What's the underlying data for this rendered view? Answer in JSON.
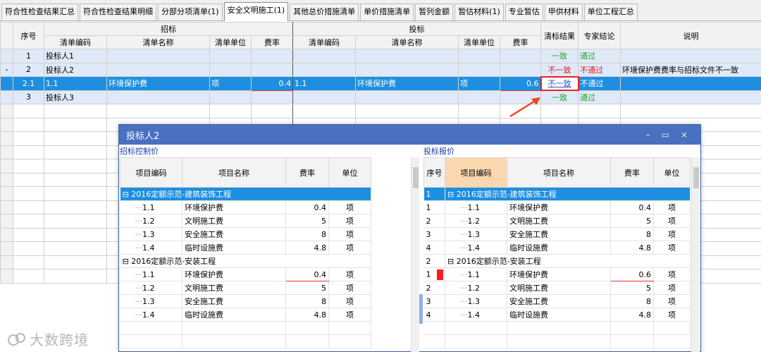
{
  "tabs": [
    {
      "label": "符合性检查结果汇总",
      "active": false
    },
    {
      "label": "符合性检查结果明细",
      "active": false
    },
    {
      "label": "分部分项清单(1)",
      "active": false
    },
    {
      "label": "安全文明施工(1)",
      "active": true
    },
    {
      "label": "其他总价措施清单",
      "active": false
    },
    {
      "label": "单价措施清单",
      "active": false
    },
    {
      "label": "暂列金额",
      "active": false
    },
    {
      "label": "暂估材料(1)",
      "active": false
    },
    {
      "label": "专业暂估",
      "active": false
    },
    {
      "label": "甲供材料",
      "active": false
    },
    {
      "label": "单位工程汇总",
      "active": false
    }
  ],
  "grid": {
    "headers": {
      "seq": "序号",
      "tender_group": "招标",
      "bid_group": "投标",
      "result": "清标结果",
      "expert": "专家结论",
      "note": "说明",
      "code": "清单编码",
      "name": "清单名称",
      "unit": "清单单位",
      "rate": "费率"
    },
    "rows": [
      {
        "mark": "",
        "seq": "1",
        "t_code": "投标人1",
        "t_name": "",
        "t_unit": "",
        "t_rate": "",
        "b_code": "",
        "b_name": "",
        "b_unit": "",
        "b_rate": "",
        "result": "一致",
        "expert": "通过",
        "note": ""
      },
      {
        "mark": "-",
        "seq": "2",
        "t_code": "投标人2",
        "t_name": "",
        "t_unit": "",
        "t_rate": "",
        "b_code": "",
        "b_name": "",
        "b_unit": "",
        "b_rate": "",
        "result": "不一致",
        "expert": "不通过",
        "note": "环境保护费费率与招标文件不一致"
      },
      {
        "mark": "",
        "seq": "2.1",
        "t_code": "1.1",
        "t_name": "环境保护费",
        "t_unit": "项",
        "t_rate": "0.4",
        "b_code": "1.1",
        "b_name": "环境保护费",
        "b_unit": "项",
        "b_rate": "0.6",
        "result": "不一致",
        "expert": "不通过",
        "note": ""
      },
      {
        "mark": "",
        "seq": "3",
        "t_code": "投标人3",
        "t_name": "",
        "t_unit": "",
        "t_rate": "",
        "b_code": "",
        "b_name": "",
        "b_unit": "",
        "b_rate": "",
        "result": "一致",
        "expert": "通过",
        "note": ""
      }
    ]
  },
  "popup": {
    "title": "投标人2",
    "buttons": {
      "min": "–",
      "max": "▭",
      "close": "×"
    },
    "left_label": "招标控制价",
    "right_label": "投标报价",
    "headers": {
      "seq": "序号",
      "code": "项目编码",
      "name": "项目名称",
      "rate": "费率",
      "unit": "单位"
    },
    "left_rows": [
      {
        "type": "group",
        "code": "⊟ 2016定额示范-建筑装饰工程"
      },
      {
        "type": "item",
        "code": "1.1",
        "name": "环境保护费",
        "rate": "0.4",
        "unit": "项"
      },
      {
        "type": "item",
        "code": "1.2",
        "name": "文明施工费",
        "rate": "5",
        "unit": "项"
      },
      {
        "type": "item",
        "code": "1.3",
        "name": "安全施工费",
        "rate": "8",
        "unit": "项"
      },
      {
        "type": "item",
        "code": "1.4",
        "name": "临时设施费",
        "rate": "4.8",
        "unit": "项"
      },
      {
        "type": "group",
        "code": "⊟ 2016定额示范-安装工程"
      },
      {
        "type": "item",
        "code": "1.1",
        "name": "环境保护费",
        "rate": "0.4",
        "unit": "项"
      },
      {
        "type": "item",
        "code": "1.2",
        "name": "文明施工费",
        "rate": "5",
        "unit": "项"
      },
      {
        "type": "item",
        "code": "1.3",
        "name": "安全施工费",
        "rate": "8",
        "unit": "项"
      },
      {
        "type": "item",
        "code": "1.4",
        "name": "临时设施费",
        "rate": "4.8",
        "unit": "项"
      }
    ],
    "right_rows": [
      {
        "type": "group",
        "seq": "1",
        "code": "⊟ 2016定额示范-建筑装饰工程"
      },
      {
        "type": "item",
        "seq": "1",
        "code": "1.1",
        "name": "环境保护费",
        "rate": "0.4",
        "unit": "项"
      },
      {
        "type": "item",
        "seq": "2",
        "code": "1.2",
        "name": "文明施工费",
        "rate": "5",
        "unit": "项"
      },
      {
        "type": "item",
        "seq": "3",
        "code": "1.3",
        "name": "安全施工费",
        "rate": "8",
        "unit": "项"
      },
      {
        "type": "item",
        "seq": "4",
        "code": "1.4",
        "name": "临时设施费",
        "rate": "4.8",
        "unit": "项"
      },
      {
        "type": "group",
        "seq": "2",
        "code": "⊟ 2016定额示范-安装工程"
      },
      {
        "type": "item",
        "seq": "1",
        "code": "1.1",
        "name": "环境保护费",
        "rate": "0.6",
        "unit": "项",
        "flag": true
      },
      {
        "type": "item",
        "seq": "2",
        "code": "1.2",
        "name": "文明施工费",
        "rate": "5",
        "unit": "项"
      },
      {
        "type": "item",
        "seq": "3",
        "code": "1.3",
        "name": "安全施工费",
        "rate": "8",
        "unit": "项"
      },
      {
        "type": "item",
        "seq": "4",
        "code": "1.4",
        "name": "临时设施费",
        "rate": "4.8",
        "unit": "项"
      }
    ]
  },
  "watermark": "大数跨境",
  "colors": {
    "accent": "#1e8fe0",
    "title_bar": "#4a70c0",
    "ok": "#28a828",
    "bad": "#e02020"
  }
}
